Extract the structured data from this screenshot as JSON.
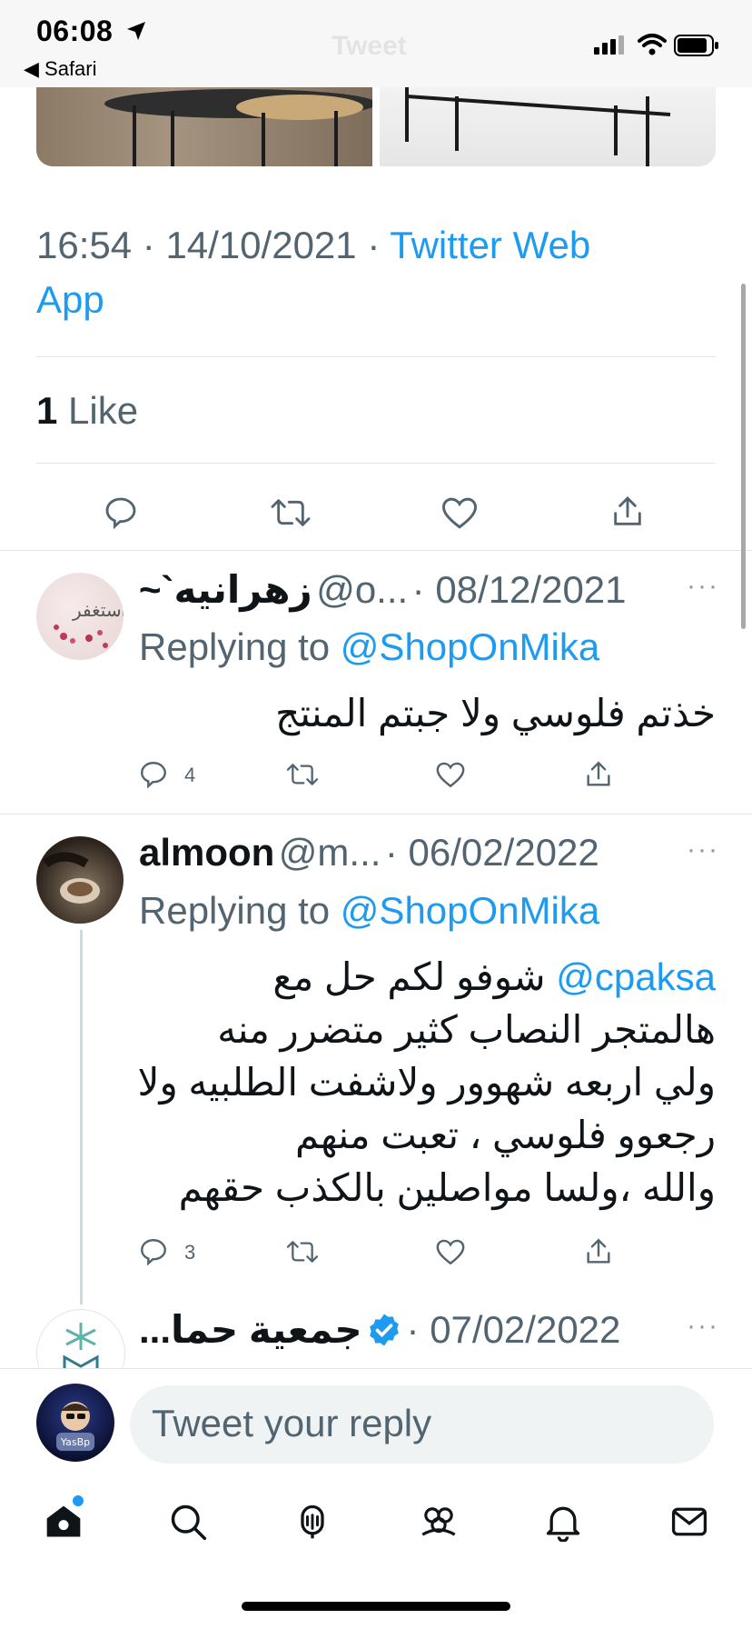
{
  "status_bar": {
    "time": "06:08",
    "back_app": "Safari",
    "ghost_title": "Tweet"
  },
  "main_tweet": {
    "time": "16:54",
    "date": "14/10/2021",
    "source_line1": "Twitter Web",
    "source_line2": "App",
    "like_count": "1",
    "like_label": "Like"
  },
  "replies": [
    {
      "name": "زهرانيه`~",
      "handle": "@o...",
      "date": "08/12/2021",
      "replying_prefix": "Replying to",
      "replying_to": "@ShopOnMika",
      "text_lines": [
        "خذتم فلوسي ولا جبتم المنتج"
      ],
      "reply_count": "4"
    },
    {
      "name": "almoon",
      "handle": "@m...",
      "date": "06/02/2022",
      "replying_prefix": "Replying to",
      "replying_to": "@ShopOnMika",
      "mention": "@cpaksa",
      "text_lines": [
        "شوفو لكم حل مع",
        "هالمتجر النصاب كثير متضرر منه",
        "ولي اربعه شهوور ولاشفت الطلبيه ولا",
        "رجعوو فلوسي ، تعبت منهم",
        "والله ،ولسا مواصلين بالكذب حقهم"
      ],
      "reply_count": "3"
    },
    {
      "name": "جمعية حما...",
      "date": "07/02/2022",
      "verified": true
    }
  ],
  "composer": {
    "placeholder": "Tweet your reply",
    "avatar_text": "YasBp"
  },
  "tabs": [
    "home-icon",
    "search-icon",
    "spaces-icon",
    "communities-icon",
    "notifications-icon",
    "messages-icon"
  ],
  "colors": {
    "accent": "#1d9bf0",
    "muted": "#536471",
    "text": "#0f1419",
    "divider": "#e1e5e8"
  }
}
